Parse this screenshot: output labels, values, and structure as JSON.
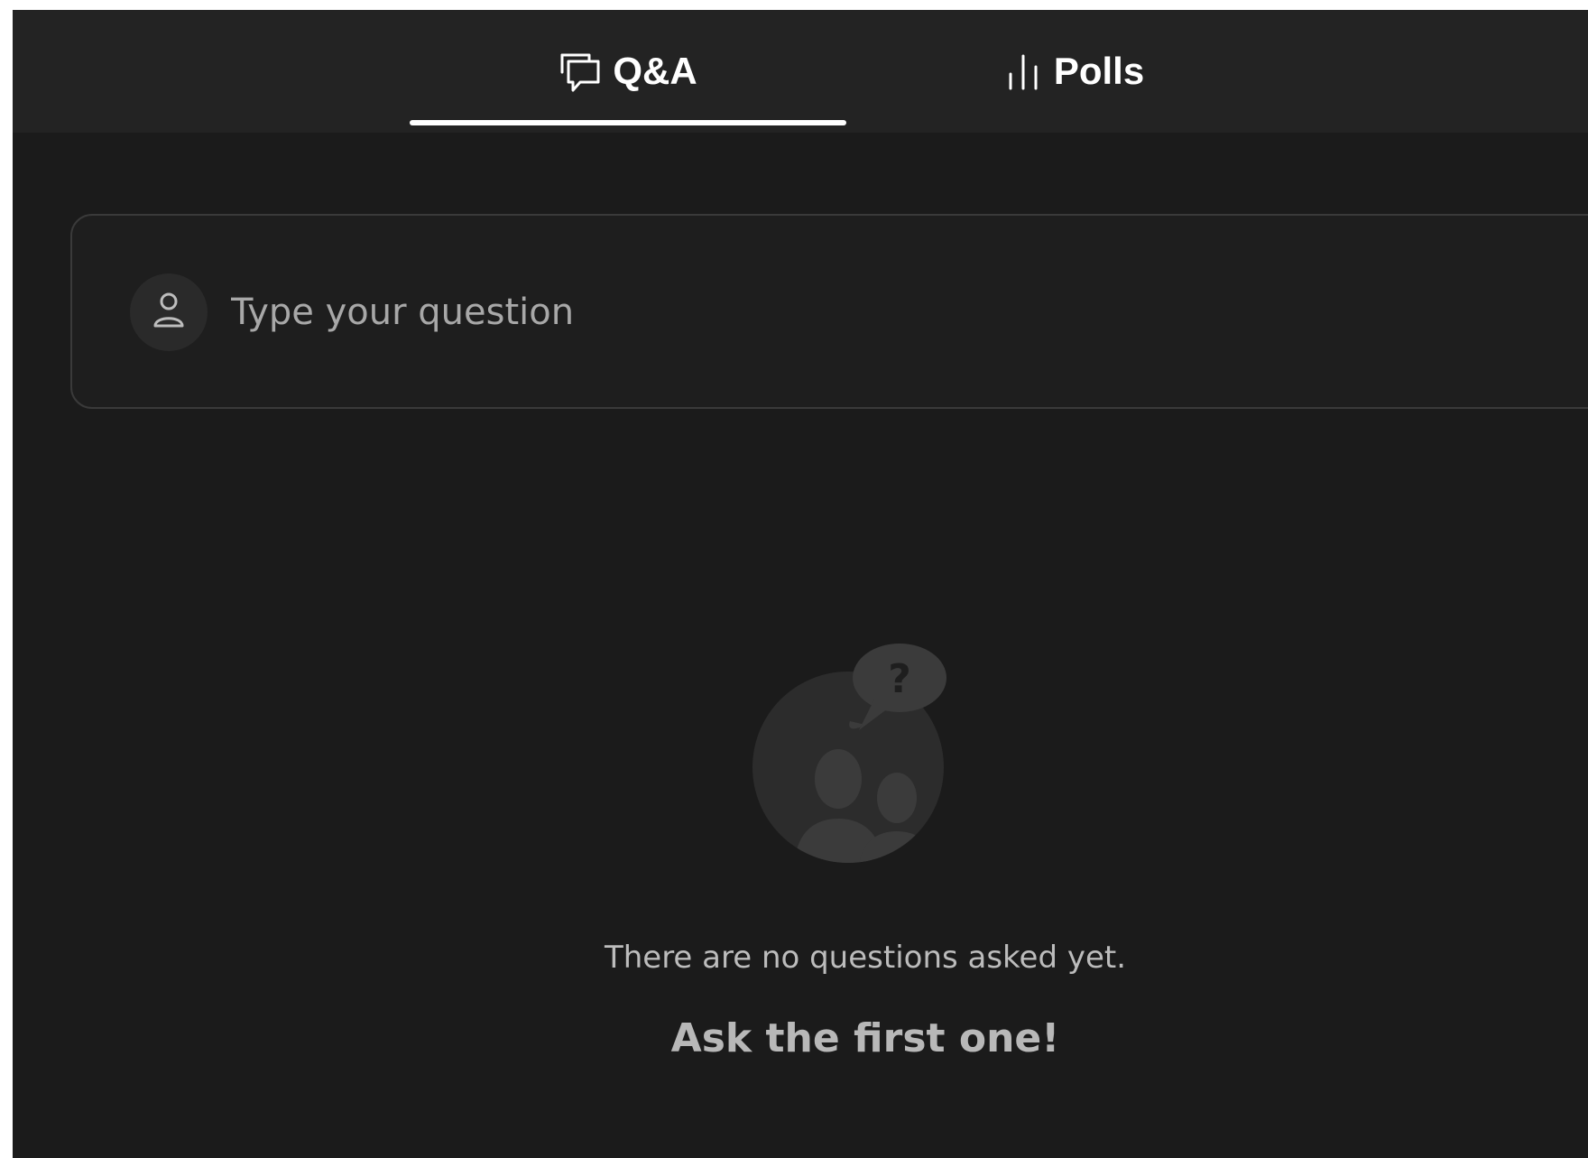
{
  "tabs": [
    {
      "label": "Q&A",
      "icon": "chat-bubbles-icon",
      "active": true
    },
    {
      "label": "Polls",
      "icon": "bar-chart-icon",
      "active": false
    }
  ],
  "question_input": {
    "placeholder": "Type your question",
    "avatar_icon": "user-icon"
  },
  "empty_state": {
    "illustration_icon": "people-question-icon",
    "illustration_text": "?",
    "message": "There are no questions asked yet.",
    "call_to_action": "Ask the first one!"
  },
  "colors": {
    "background": "#1b1b1b",
    "tab_bar": "#232323",
    "active_indicator": "#ffffff",
    "input_border": "#3a3a3a"
  }
}
